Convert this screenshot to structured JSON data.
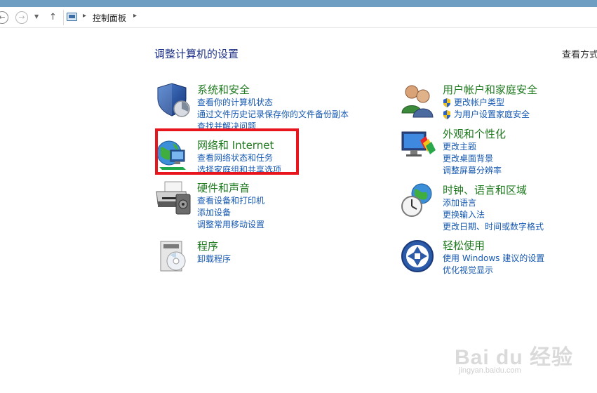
{
  "address_bar": {
    "back_glyph": "←",
    "forward_glyph": "→",
    "dropdown_glyph": "▼",
    "up_glyph": "↑",
    "separator_glyph": "▸",
    "breadcrumb": "控制面板",
    "breadcrumb_sep": "▸"
  },
  "main": {
    "heading": "调整计算机的设置",
    "view_by": "查看方式"
  },
  "categories": [
    {
      "title": "系统和安全",
      "icon": "shield-icon",
      "links": [
        "查看你的计算机状态",
        "通过文件历史记录保存你的文件备份副本",
        "查找并解决问题"
      ]
    },
    {
      "title": "网络和 Internet",
      "icon": "network-globe-icon",
      "links": [
        "查看网络状态和任务",
        "选择家庭组和共享选项"
      ]
    },
    {
      "title": "硬件和声音",
      "icon": "printer-icon",
      "links": [
        "查看设备和打印机",
        "添加设备",
        "调整常用移动设置"
      ]
    },
    {
      "title": "程序",
      "icon": "programs-icon",
      "links": [
        "卸载程序"
      ]
    },
    {
      "title": "用户帐户和家庭安全",
      "icon": "users-icon",
      "links": [
        "更改帐户类型",
        "为用户设置家庭安全"
      ]
    },
    {
      "title": "外观和个性化",
      "icon": "monitor-palette-icon",
      "links": [
        "更改主题",
        "更改桌面背景",
        "调整屏幕分辨率"
      ]
    },
    {
      "title": "时钟、语言和区域",
      "icon": "clock-globe-icon",
      "links": [
        "添加语言",
        "更换输入法",
        "更改日期、时间或数字格式"
      ]
    },
    {
      "title": "轻松使用",
      "icon": "ease-of-access-icon",
      "links": [
        "使用 Windows 建议的设置",
        "优化视觉显示"
      ]
    }
  ],
  "watermark": {
    "brand": "Bai du 经验",
    "url": "jingyan.baidu.com"
  },
  "colors": {
    "category_title": "#1f7a1f",
    "link": "#1558b0",
    "heading": "#1e3287",
    "highlight": "#e8161c"
  }
}
